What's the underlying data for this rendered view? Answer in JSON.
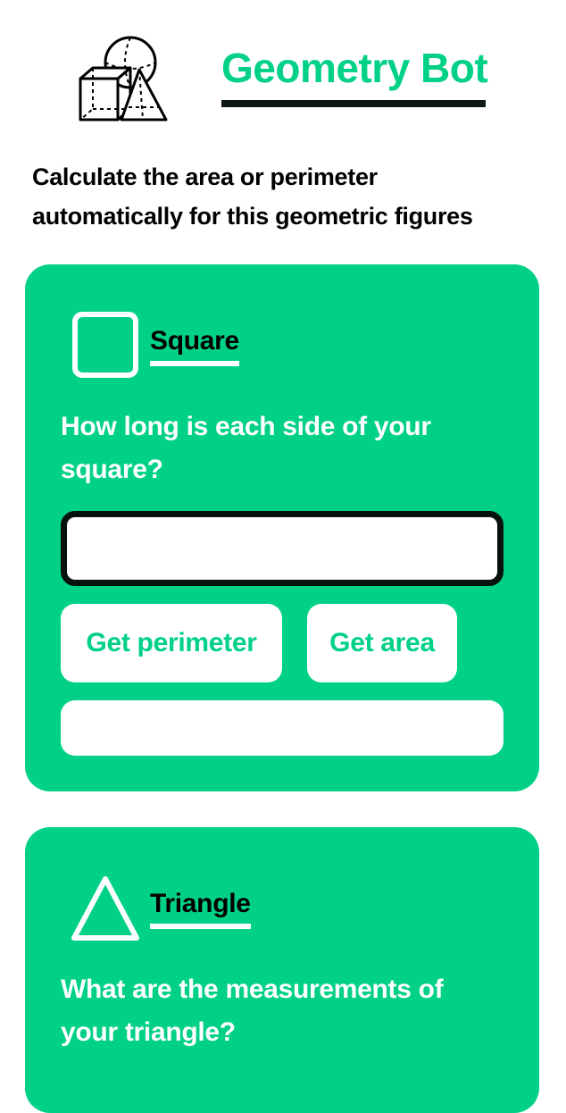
{
  "header": {
    "title": "Geometry Bot",
    "logo_icon": "geometric-shapes-icon"
  },
  "intro": "Calculate the area or perimeter automatically for this geometric figures",
  "colors": {
    "accent": "#00d186",
    "dark": "#0b1a12",
    "white": "#ffffff"
  },
  "cards": {
    "square": {
      "name": "Square",
      "icon": "square-icon",
      "question": "How long is each side of your square?",
      "input_value": "",
      "perimeter_label": "Get perimeter",
      "area_label": "Get area",
      "result": ""
    },
    "triangle": {
      "name": "Triangle",
      "icon": "triangle-icon",
      "question": "What are the measurements of your triangle?"
    }
  }
}
